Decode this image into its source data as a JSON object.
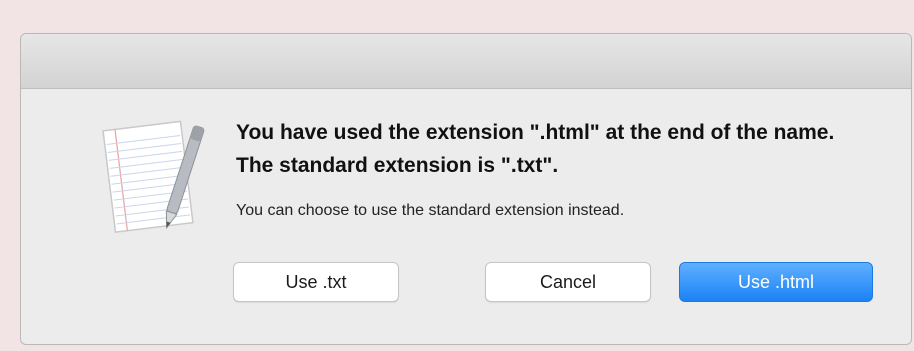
{
  "dialog": {
    "headline": "You have used the extension \".html\" at the end of the name. The standard extension is \".txt\".",
    "message": "You can choose to use the standard extension instead.",
    "icon": "textedit-document-icon"
  },
  "buttons": {
    "use_txt": "Use .txt",
    "cancel": "Cancel",
    "use_html": "Use .html"
  },
  "colors": {
    "primary_button": "#1b82f5",
    "backdrop": "#f2e3e4"
  }
}
